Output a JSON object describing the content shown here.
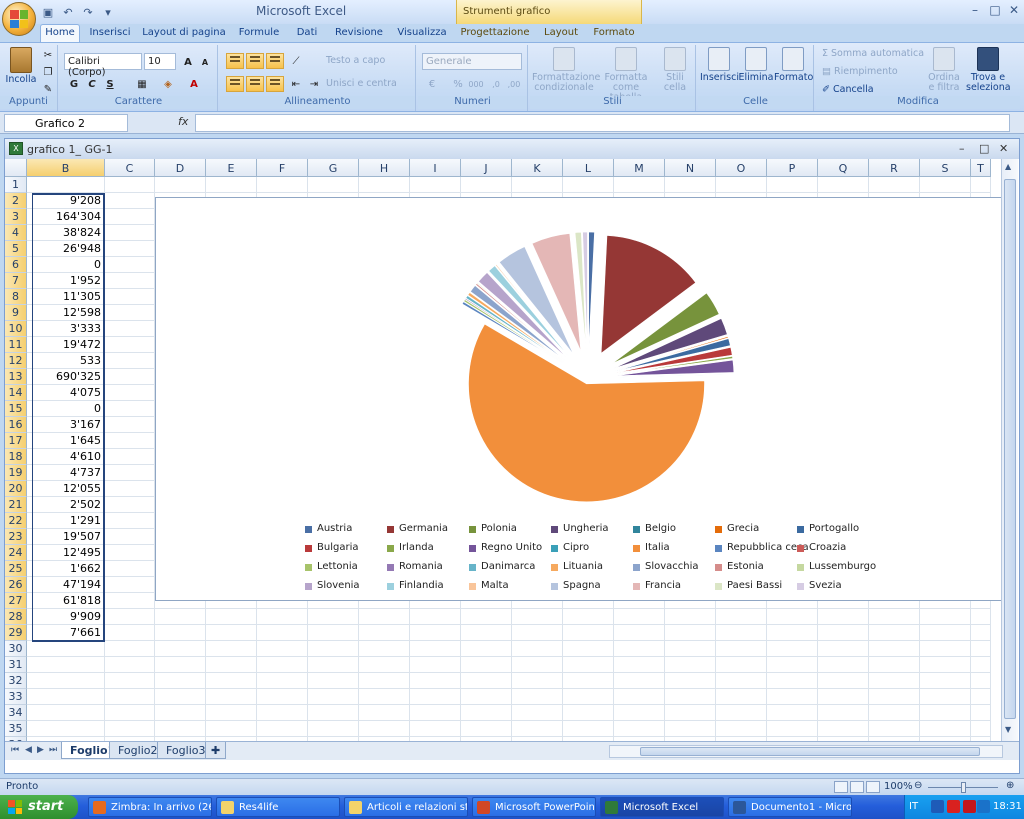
{
  "titlebar": {
    "app_title": "Microsoft Excel",
    "context_title": "Strumenti grafico"
  },
  "tabs": [
    "Home",
    "Inserisci",
    "Layout di pagina",
    "Formule",
    "Dati",
    "Revisione",
    "Visualizza",
    "Progettazione",
    "Layout",
    "Formato"
  ],
  "ribbon": {
    "clipboard": {
      "paste": "Incolla",
      "label": "Appunti"
    },
    "font": {
      "name": "Calibri (Corpo)",
      "size": "10",
      "bold": "G",
      "italic": "C",
      "underline": "S",
      "label": "Carattere"
    },
    "alignment": {
      "wrap": "Testo a capo",
      "merge": "Unisci e centra",
      "label": "Allineamento"
    },
    "number": {
      "format": "Generale",
      "label": "Numeri"
    },
    "styles": {
      "conditional": "Formattazione condizionale",
      "table": "Formatta come tabella",
      "cell": "Stili cella",
      "label": "Stili"
    },
    "cells": {
      "insert": "Inserisci",
      "delete": "Elimina",
      "format": "Formato",
      "label": "Celle"
    },
    "editing": {
      "autosum": "Somma automatica",
      "fill": "Riempimento",
      "clear": "Cancella",
      "sort": "Ordina e filtra",
      "find": "Trova e seleziona",
      "label": "Modifica"
    }
  },
  "formula_bar": {
    "name_box": "Grafico 2",
    "fx": "fx",
    "formula": ""
  },
  "workbook": {
    "title": "grafico 1_ GG-1",
    "columns": [
      "B",
      "C",
      "D",
      "E",
      "F",
      "G",
      "H",
      "I",
      "J",
      "K",
      "L",
      "M",
      "N",
      "O",
      "P",
      "Q",
      "R",
      "S",
      "T"
    ],
    "rows": [
      "1",
      "2",
      "3",
      "4",
      "5",
      "6",
      "7",
      "8",
      "9",
      "10",
      "11",
      "12",
      "13",
      "14",
      "15",
      "16",
      "17",
      "18",
      "19",
      "20",
      "21",
      "22",
      "23",
      "24",
      "25",
      "26",
      "27",
      "28",
      "29",
      "30",
      "31",
      "32",
      "33",
      "34",
      "35",
      "36"
    ],
    "column_b_values": [
      "",
      "9'208",
      "164'304",
      "38'824",
      "26'948",
      "0",
      "1'952",
      "11'305",
      "12'598",
      "3'333",
      "19'472",
      "533",
      "690'325",
      "4'075",
      "0",
      "3'167",
      "1'645",
      "4'610",
      "4'737",
      "12'055",
      "2'502",
      "1'291",
      "19'507",
      "12'495",
      "1'662",
      "47'194",
      "61'818",
      "9'909",
      "7'661"
    ]
  },
  "chart_data": {
    "type": "pie",
    "title": "",
    "exploded": true,
    "legend_position": "bottom",
    "categories": [
      "Austria",
      "Germania",
      "Polonia",
      "Ungheria",
      "Belgio",
      "Grecia",
      "Portogallo",
      "Bulgaria",
      "Irlanda",
      "Regno Unito",
      "Cipro",
      "Italia",
      "Repubblica ceca",
      "Croazia",
      "Lettonia",
      "Romania",
      "Danimarca",
      "Lituania",
      "Slovacchia",
      "Estonia",
      "Lussemburgo",
      "Slovenia",
      "Finlandia",
      "Malta",
      "Spagna",
      "Francia",
      "Paesi Bassi",
      "Svezia"
    ],
    "values": [
      9208,
      164304,
      38824,
      26948,
      0,
      1952,
      11305,
      12598,
      3333,
      19472,
      533,
      690325,
      4075,
      0,
      3167,
      1645,
      4610,
      4737,
      12055,
      2502,
      1291,
      19507,
      12495,
      1662,
      47194,
      61818,
      9909,
      7661
    ],
    "colors": [
      "#4a6fa5",
      "#953735",
      "#77933c",
      "#5f497a",
      "#31859c",
      "#e46c0a",
      "#3b6aa0",
      "#b9393a",
      "#8aa84a",
      "#74549a",
      "#3aa0b8",
      "#f28f3b",
      "#5a85c0",
      "#cc5b58",
      "#a7c36a",
      "#9479b4",
      "#67b4c9",
      "#f6a95f",
      "#8ca4cc",
      "#d58c8a",
      "#c5d8a0",
      "#b6a4cb",
      "#9cd0de",
      "#f9c59a",
      "#b5c4de",
      "#e4b7b6",
      "#dbe6c6",
      "#d6cce3"
    ]
  },
  "sheet_tabs": [
    "Foglio1",
    "Foglio2",
    "Foglio3"
  ],
  "status": {
    "text": "Pronto",
    "zoom": "100%"
  },
  "taskbar": {
    "start": "start",
    "tasks": [
      "Zimbra: In arrivo (26...",
      "Res4life",
      "Articoli e relazioni sta...",
      "Microsoft PowerPoint ...",
      "Microsoft Excel",
      "Documento1 - Micros..."
    ],
    "lang": "IT",
    "clock": "18:31"
  }
}
